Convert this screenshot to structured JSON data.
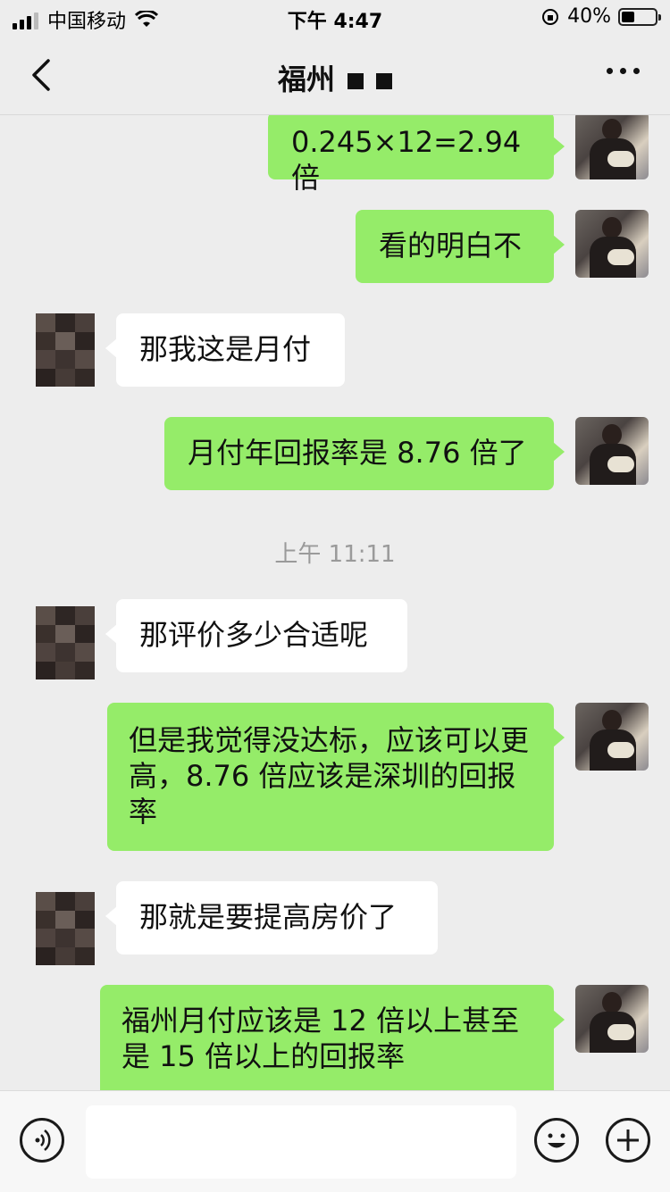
{
  "status_bar": {
    "carrier": "中国移动",
    "time": "下午 4:47",
    "battery": "40%"
  },
  "nav": {
    "title": "福州",
    "back_icon": "chevron-left-icon",
    "more_icon": "more-dots-icon"
  },
  "messages": [
    {
      "side": "me",
      "text": "0.245×12=2.94 倍"
    },
    {
      "side": "me",
      "text": "看的明白不"
    },
    {
      "side": "other",
      "text": "那我这是月付"
    },
    {
      "side": "me",
      "text": "月付年回报率是 8.76 倍了"
    },
    {
      "side": "timestamp",
      "text": "上午 11:11"
    },
    {
      "side": "other",
      "text": "那评价多少合适呢"
    },
    {
      "side": "me",
      "text": "但是我觉得没达标，应该可以更高，8.76 倍应该是深圳的回报率"
    },
    {
      "side": "other",
      "text": "那就是要提高房价了"
    },
    {
      "side": "me",
      "text": "福州月付应该是 12 倍以上甚至是 15 倍以上的回报率"
    }
  ],
  "input_bar": {
    "placeholder": "",
    "voice_icon": "voice-icon",
    "emoji_icon": "emoji-icon",
    "plus_icon": "plus-icon"
  },
  "colors": {
    "my_bubble": "#95ec69",
    "other_bubble": "#ffffff",
    "background": "#ededed"
  }
}
